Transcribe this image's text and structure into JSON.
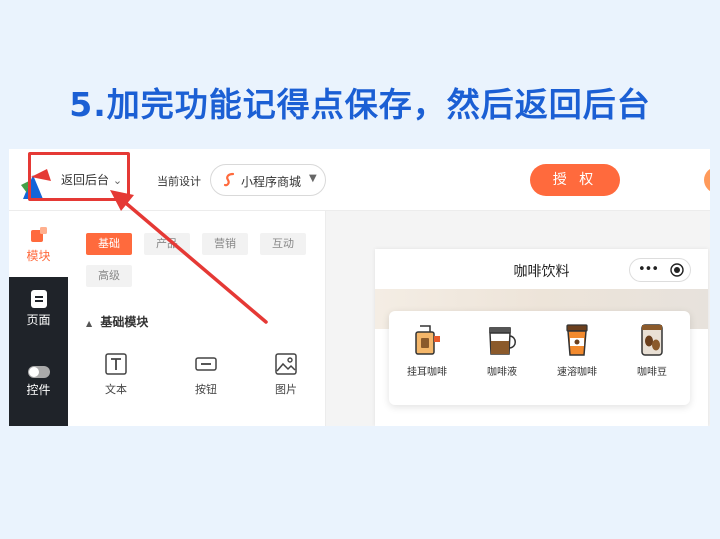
{
  "headline": "5.加完功能记得点保存，然后返回后台",
  "topbar": {
    "back_label": "返回后台",
    "back_chevron": "⌄",
    "current_design_label": "当前设计",
    "design_select_value": "小程序商城",
    "authorize_label": "授 权"
  },
  "nav": {
    "items": [
      {
        "label": "模块",
        "icon": "modules-icon",
        "active": true
      },
      {
        "label": "页面",
        "icon": "page-icon",
        "active": false
      },
      {
        "label": "控件",
        "icon": "toggle-icon",
        "active": false
      }
    ]
  },
  "panel": {
    "tabs": [
      "基础",
      "产品",
      "营销",
      "互动",
      "高级"
    ],
    "active_tab": "基础",
    "section_title": "基础模块",
    "section_marker": "▲",
    "tools": [
      {
        "label": "文本",
        "icon": "text-icon"
      },
      {
        "label": "按钮",
        "icon": "button-icon"
      },
      {
        "label": "图片",
        "icon": "image-icon"
      }
    ]
  },
  "preview": {
    "title": "咖啡饮料",
    "categories": [
      {
        "label": "挂耳咖啡",
        "icon": "drip-bag-icon"
      },
      {
        "label": "咖啡液",
        "icon": "coffee-pot-icon"
      },
      {
        "label": "速溶咖啡",
        "icon": "coffee-cup-icon"
      },
      {
        "label": "咖啡豆",
        "icon": "coffee-beans-icon"
      }
    ]
  },
  "colors": {
    "accent": "#ff6a3d",
    "headline": "#1b5fd4",
    "highlight": "#e53935",
    "nav_bg": "#1f2329",
    "page_bg": "#eaf3fd"
  }
}
